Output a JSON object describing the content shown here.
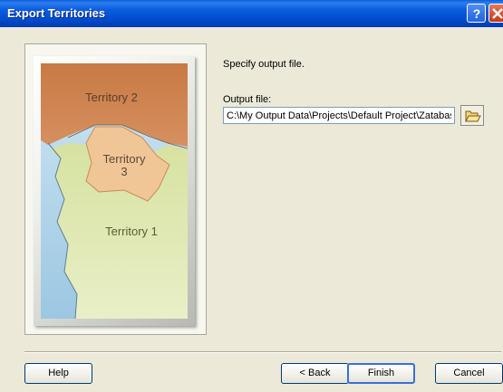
{
  "window": {
    "title": "Export Territories"
  },
  "map_labels": {
    "territory_2": "Territory 2",
    "territory_3_line1": "Territory",
    "territory_3_line2": "3",
    "territory_1": "Territory 1"
  },
  "form": {
    "prompt": "Specify output file.",
    "output_label": "Output file:",
    "output_value": "C:\\My Output Data\\Projects\\Default Project\\Zatabas"
  },
  "icons": {
    "help": "help-icon",
    "close": "close-icon",
    "browse": "folder-open-icon"
  },
  "buttons": {
    "help": "Help",
    "back": "< Back",
    "finish": "Finish",
    "cancel": "Cancel"
  }
}
